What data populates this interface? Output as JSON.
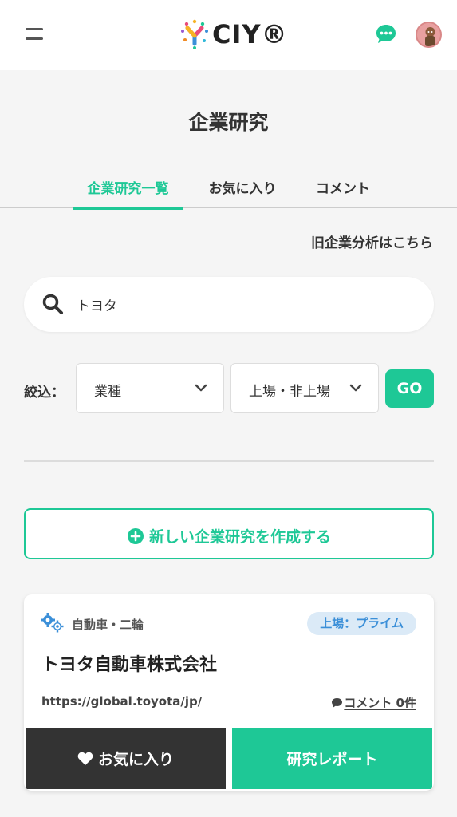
{
  "header": {
    "logo_text": "CIY®",
    "icons": {
      "menu": "hamburger-menu-icon",
      "chat": "chat-bubble-icon",
      "avatar": "user-avatar"
    }
  },
  "page": {
    "title": "企業研究"
  },
  "tabs": [
    {
      "label": "企業研究一覧",
      "active": true
    },
    {
      "label": "お気に入り",
      "active": false
    },
    {
      "label": "コメント",
      "active": false
    }
  ],
  "old_analysis_link": "旧企業分析はこちら",
  "search": {
    "value": "トヨタ",
    "placeholder": ""
  },
  "filter": {
    "label": "絞込：",
    "industry_select": "業種",
    "listing_select": "上場・非上場",
    "go_label": "GO"
  },
  "create_button": {
    "label": "新しい企業研究を作成する"
  },
  "results": [
    {
      "industry": "自動車・二輪",
      "listing_badge": "上場：プライム",
      "company_name": "トヨタ自動車株式会社",
      "url": "https://global.toyota/jp/",
      "comments": "コメント 0件",
      "favorite_label": "お気に入り",
      "report_label": "研究レポート"
    }
  ],
  "colors": {
    "accent": "#1ec896",
    "badge_bg": "#dbeaf7",
    "badge_text": "#3b8fd8",
    "dark_button": "#333333"
  }
}
